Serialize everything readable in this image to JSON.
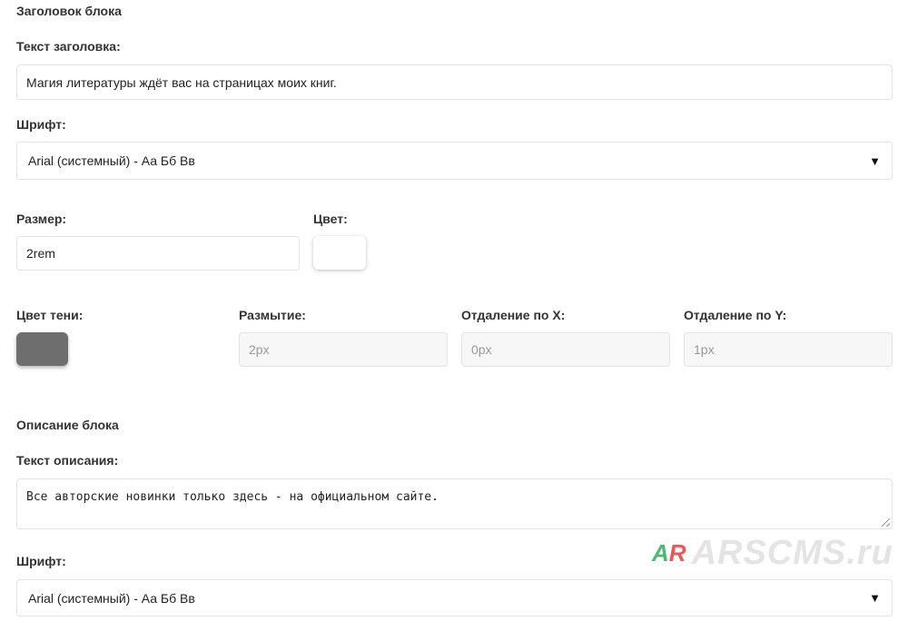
{
  "header_block": {
    "section_title": "Заголовок блока",
    "text_label": "Текст заголовка:",
    "text_value": "Магия литературы ждёт вас на страницах моих книг.",
    "font_label": "Шрифт:",
    "font_value": "Arial (системный) - Аа Бб Вв",
    "size_label": "Размер:",
    "size_value": "2rem",
    "color_label": "Цвет:",
    "color_value": "#ffffff",
    "shadow_color_label": "Цвет тени:",
    "shadow_color_value": "#6e6e6e",
    "blur_label": "Размытие:",
    "blur_placeholder": "2px",
    "offset_x_label": "Отдаление по X:",
    "offset_x_placeholder": "0px",
    "offset_y_label": "Отдаление по Y:",
    "offset_y_placeholder": "1px"
  },
  "description_block": {
    "section_title": "Описание блока",
    "text_label": "Текст описания:",
    "text_value": "Все авторские новинки только здесь - на официальном сайте.",
    "font_label": "Шрифт:",
    "font_value": "Arial (системный) - Аа Бб Вв"
  },
  "watermark": {
    "logo": "AR",
    "text": "ARSCMS.ru"
  },
  "icons": {
    "dropdown": "chevron-down-icon",
    "resize": "resize-handle-icon"
  }
}
